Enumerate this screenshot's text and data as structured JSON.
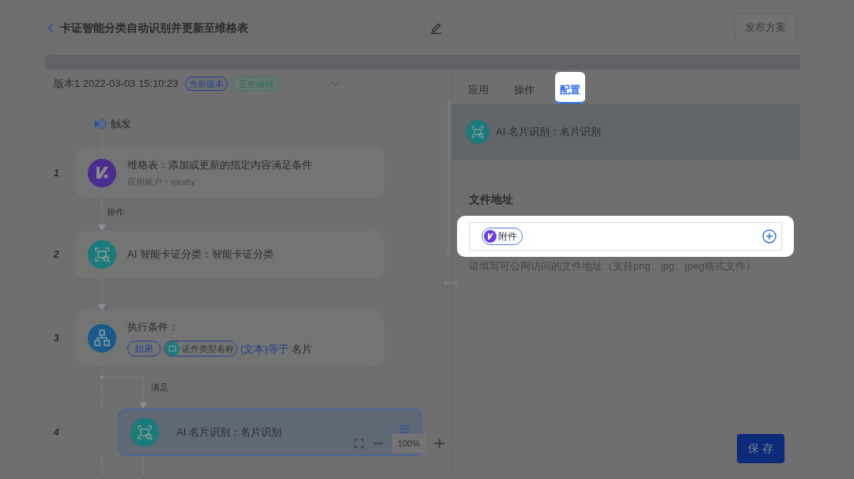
{
  "header": {
    "title": "卡证智能分类自动识别并更新至维格表",
    "publish_button": {
      "label": "发布方案",
      "disabled": true
    }
  },
  "version": {
    "name": "版本1",
    "time": "2022-03-03 15:10:23",
    "badges": [
      {
        "kind": "pill",
        "text": "当前版本"
      },
      {
        "kind": "tag",
        "text": "正在编辑"
      }
    ]
  },
  "flow": {
    "trigger": "触发",
    "nodes": [
      {
        "number": "1",
        "kind": "vika",
        "title": "维格表：添加或更新的指定内容满足条件",
        "subtitle": "应用账户：vikaby",
        "selected": false
      },
      {
        "number": "2",
        "kind": "scan",
        "edge_label": "操作",
        "title": "AI 智能卡证分类：智能卡证分类",
        "selected": false
      },
      {
        "number": "3",
        "kind": "branch",
        "title": "执行条件：",
        "condition": [
          {
            "kind": "keyword",
            "text": "如果"
          },
          {
            "kind": "field",
            "text": "证件类型名称"
          },
          {
            "kind": "operator",
            "text": "(文本)等于"
          },
          {
            "kind": "value",
            "text": "名片"
          }
        ],
        "selected": false
      },
      {
        "number": "4",
        "kind": "scan",
        "edge_label": "满足",
        "branch": true,
        "title": "AI 名片识别：名片识别",
        "selected": true
      }
    ],
    "zoom": "100%"
  },
  "tabs": [
    {
      "label": "应用",
      "selected": false
    },
    {
      "label": "操作",
      "selected": false
    },
    {
      "label": "配置",
      "selected": true
    }
  ],
  "panel": {
    "title": "AI 名片识别：名片识别",
    "field_label": "文件地址",
    "chip": "附件",
    "help": "请填写可公网访问的文件地址（支持png、jpg、jpeg格式文件）",
    "save_button": "保 存"
  }
}
